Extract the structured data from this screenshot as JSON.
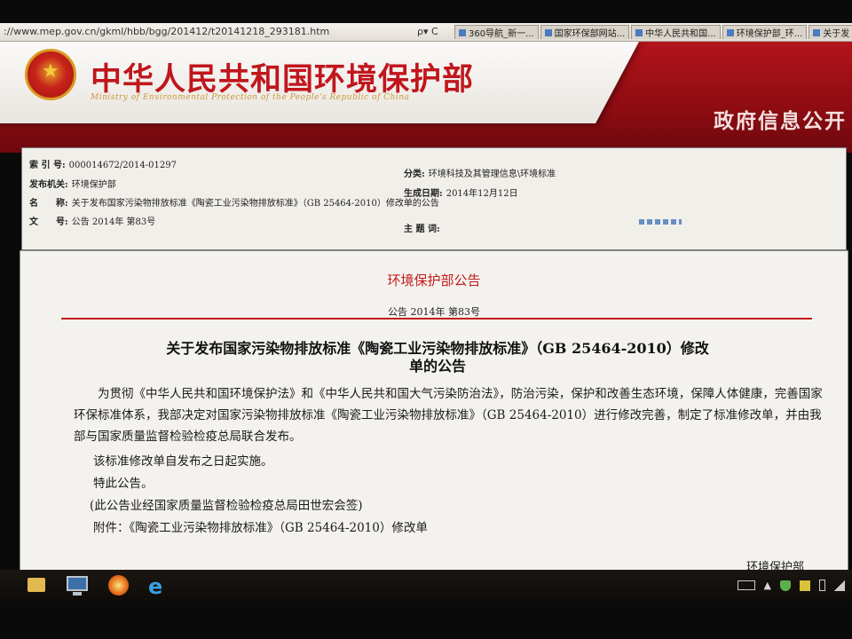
{
  "browser": {
    "url": "://www.mep.gov.cn/gkml/hbb/bgg/201412/t20141218_293181.htm",
    "nav_icons": "ρ▾ C",
    "tabs": [
      {
        "label": "360导航_新一..."
      },
      {
        "label": "国家环保部网站..."
      },
      {
        "label": "中华人民共和国..."
      },
      {
        "label": "环境保护部_环..."
      },
      {
        "label": "关于发"
      }
    ]
  },
  "banner": {
    "title": "中华人民共和国环境保护部",
    "subtitle": "Ministry of Environmental Protection of the People's Republic of China",
    "section": "政府信息公开"
  },
  "meta": {
    "index_no_label": "索 引 号:",
    "index_no": "000014672/2014-01297",
    "issuer_label": "发布机关:",
    "issuer": "环境保护部",
    "name_label": "名　　称:",
    "name": "关于发布国家污染物排放标准《陶瓷工业污染物排放标准》（GB 25464-2010）修改单的公告",
    "doc_no_label": "文　　号:",
    "doc_no": "公告 2014年 第83号",
    "category_label": "分类:",
    "category": "环境科技及其管理信息\\环境标准",
    "date_label": "生成日期:",
    "date": "2014年12月12日",
    "keywords_label": "主 题 词:",
    "keywords": ""
  },
  "content": {
    "ann_label": "环境保护部公告",
    "ann_no": "公告 2014年 第83号",
    "title_line1": "关于发布国家污染物排放标准《陶瓷工业污染物排放标准》（GB 25464-2010）修改",
    "title_line2": "单的公告",
    "body": "为贯彻《中华人民共和国环境保护法》和《中华人民共和国大气污染防治法》，防治污染，保护和改善生态环境，保障人体健康，完善国家环保标准体系，我部决定对国家污染物排放标准《陶瓷工业污染物排放标准》（GB 25464-2010）进行修改完善，制定了标准修改单，并由我部与国家质量监督检验检疫总局联合发布。",
    "effective": "该标准修改单自发布之日起实施。",
    "special": "特此公告。",
    "note": "(此公告业经国家质量监督检验检疫总局田世宏会签)",
    "attachment": "附件：《陶瓷工业污染物排放标准》（GB 25464-2010）修改单",
    "issuer": "环境保护部"
  }
}
